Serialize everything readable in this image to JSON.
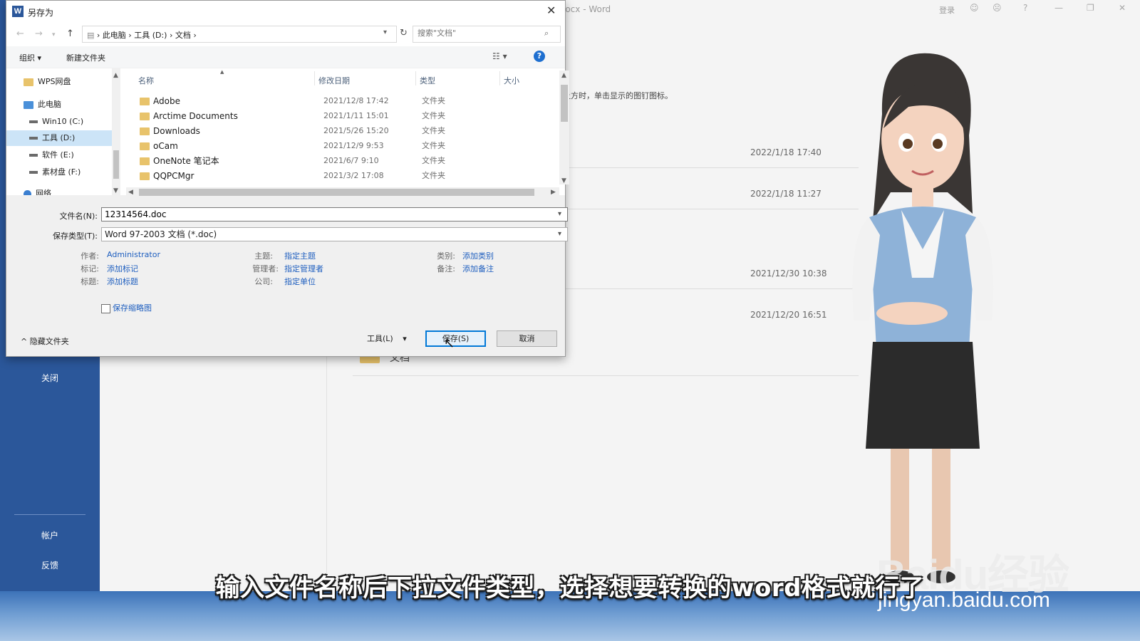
{
  "word": {
    "title_fragment": "locx - Word",
    "signin": "登录",
    "window_controls": [
      "☺",
      "☹",
      "?",
      "—",
      "❐",
      "✕"
    ],
    "sidebar": {
      "close": "关闭",
      "account": "帐户",
      "feedback": "反馈"
    },
    "recent_hint": "上方时，单击显示的图钉图标。",
    "recent_dates": [
      "2022/1/18 17:40",
      "2022/1/18 11:27",
      "2021/12/30 10:38",
      "2021/12/20 16:51"
    ],
    "folder_label": "文档"
  },
  "dialog": {
    "title": "另存为",
    "app_icon": "W",
    "breadcrumb": [
      "此电脑",
      "工具 (D:)",
      "文档"
    ],
    "search_placeholder": "搜索\"文档\"",
    "toolbar": {
      "organize": "组织 ▾",
      "new_folder": "新建文件夹",
      "help": "?"
    },
    "nav_items": [
      {
        "label": "WPS网盘",
        "icon": "folder"
      },
      {
        "label": "此电脑",
        "icon": "pc"
      },
      {
        "label": "Win10 (C:)",
        "icon": "drive"
      },
      {
        "label": "工具 (D:)",
        "icon": "drive",
        "selected": true
      },
      {
        "label": "软件 (E:)",
        "icon": "drive"
      },
      {
        "label": "素材盘 (F:)",
        "icon": "drive"
      },
      {
        "label": "网络",
        "icon": "network"
      }
    ],
    "columns": [
      "名称",
      "修改日期",
      "类型",
      "大小"
    ],
    "files": [
      {
        "name": "Adobe",
        "date": "2021/12/8 17:42",
        "type": "文件夹"
      },
      {
        "name": "Arctime Documents",
        "date": "2021/1/11 15:01",
        "type": "文件夹"
      },
      {
        "name": "Downloads",
        "date": "2021/5/26 15:20",
        "type": "文件夹"
      },
      {
        "name": "oCam",
        "date": "2021/12/9 9:53",
        "type": "文件夹"
      },
      {
        "name": "OneNote 笔记本",
        "date": "2021/6/7 9:10",
        "type": "文件夹"
      },
      {
        "name": "QQPCMgr",
        "date": "2021/3/2 17:08",
        "type": "文件夹"
      }
    ],
    "filename_label": "文件名(N):",
    "filename_value": "12314564.doc",
    "filetype_label": "保存类型(T):",
    "filetype_value": "Word 97-2003 文档 (*.doc)",
    "meta": {
      "author_label": "作者:",
      "author_value": "Administrator",
      "tags_label": "标记:",
      "tags_value": "添加标记",
      "title_label": "标题:",
      "title_value": "添加标题",
      "subject_label": "主题:",
      "subject_value": "指定主题",
      "manager_label": "管理者:",
      "manager_value": "指定管理者",
      "company_label": "公司:",
      "company_value": "指定单位",
      "category_label": "类别:",
      "category_value": "添加类别",
      "comments_label": "备注:",
      "comments_value": "添加备注"
    },
    "save_thumbnail": "保存缩略图",
    "hide_folders": "^ 隐藏文件夹",
    "tools": "工具(L)",
    "save": "保存(S)",
    "cancel": "取消"
  },
  "caption": "输入文件名称后下拉文件类型，选择想要转换的word格式就行了",
  "watermark": {
    "brand": "Baidu经验",
    "url": "jingyan.baidu.com"
  },
  "colors": {
    "word_blue": "#2b579a",
    "accent": "#0078d7",
    "link": "#1f5fbf"
  }
}
